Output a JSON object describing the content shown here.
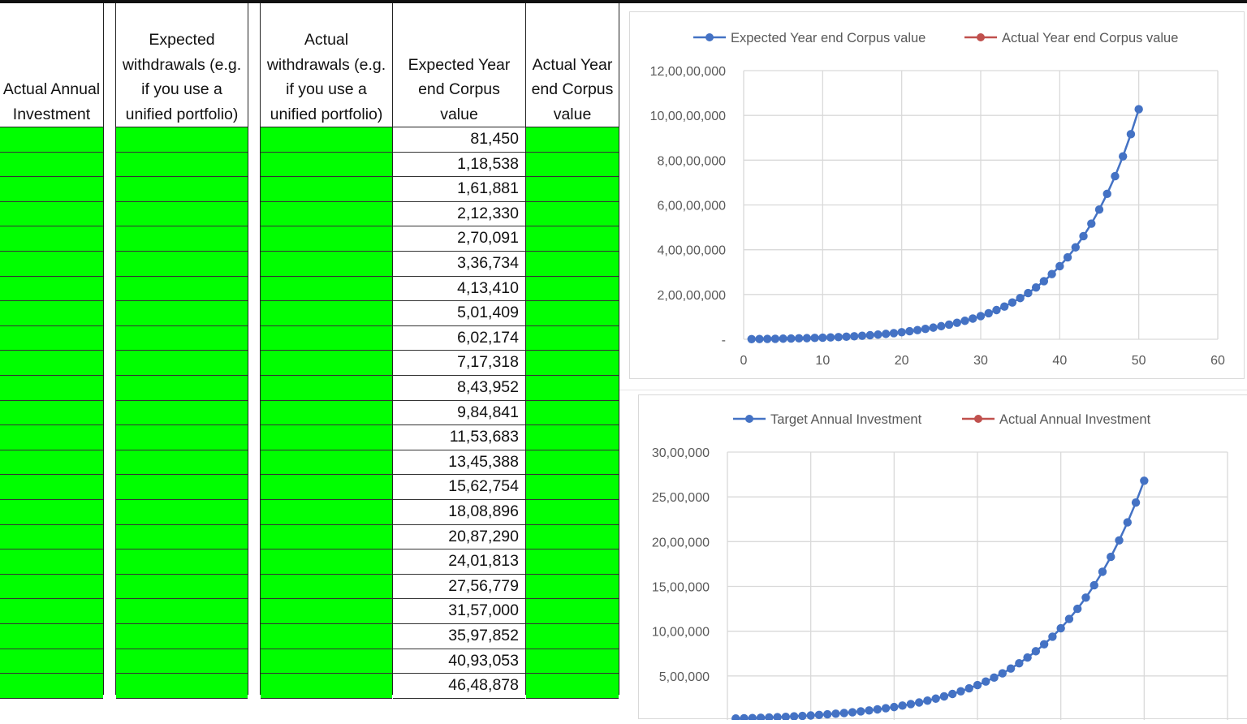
{
  "table": {
    "headers": {
      "actual_annual_investment": "Actual Annual Investment",
      "expected_withdrawals": "Expected withdrawals (e.g. if you use a unified portfolio)",
      "actual_withdrawals": "Actual withdrawals (e.g. if you use a unified portfolio)",
      "expected_corpus": "Expected Year end Corpus value",
      "actual_corpus": "Actual Year end Corpus value"
    },
    "expected_corpus_values": [
      "81,450",
      "1,18,538",
      "1,61,881",
      "2,12,330",
      "2,70,091",
      "3,36,734",
      "4,13,410",
      "5,01,409",
      "6,02,174",
      "7,17,318",
      "8,43,952",
      "9,84,841",
      "11,53,683",
      "13,45,388",
      "15,62,754",
      "18,08,896",
      "20,87,290",
      "24,01,813",
      "27,56,779",
      "31,57,000",
      "35,97,852",
      "40,93,053",
      "46,48,878"
    ],
    "input_cell_color": "#00ff00"
  },
  "chart_data": [
    {
      "type": "line",
      "legend": [
        {
          "name": "Expected Year end Corpus value",
          "color": "#4472c4"
        },
        {
          "name": "Actual Year end Corpus value",
          "color": "#c0504d"
        }
      ],
      "legend_position": "top",
      "grid": true,
      "xlim": [
        0,
        60
      ],
      "ylim": [
        0,
        120000000
      ],
      "x_ticks": [
        "0",
        "10",
        "20",
        "30",
        "40",
        "50",
        "60"
      ],
      "y_ticks": [
        {
          "value": 0,
          "label": "-"
        },
        {
          "value": 20000000,
          "label": "2,00,00,000"
        },
        {
          "value": 40000000,
          "label": "4,00,00,000"
        },
        {
          "value": 60000000,
          "label": "6,00,00,000"
        },
        {
          "value": 80000000,
          "label": "8,00,00,000"
        },
        {
          "value": 100000000,
          "label": "10,00,00,000"
        },
        {
          "value": 120000000,
          "label": "12,00,00,000"
        }
      ],
      "series": [
        {
          "name": "Expected Year end Corpus value",
          "x": [
            1,
            2,
            3,
            4,
            5,
            6,
            7,
            8,
            9,
            10,
            11,
            12,
            13,
            14,
            15,
            16,
            17,
            18,
            19,
            20,
            21,
            22,
            23,
            24,
            25,
            26,
            27,
            28,
            29,
            30,
            31,
            32,
            33,
            34,
            35,
            36,
            37,
            38,
            39,
            40,
            41,
            42,
            43,
            44,
            45,
            46,
            47,
            48,
            49,
            50
          ],
          "y": [
            81450,
            118538,
            161881,
            212330,
            270091,
            336734,
            413410,
            501409,
            602174,
            717318,
            843952,
            984841,
            1153683,
            1345388,
            1562754,
            1808896,
            2087290,
            2401813,
            2756779,
            3157000,
            3597852,
            4093053,
            4648878,
            5214000,
            5847000,
            6557000,
            7354000,
            8247000,
            9249000,
            10370000,
            11630000,
            13050000,
            14630000,
            16410000,
            18400000,
            20640000,
            23150000,
            25960000,
            29110000,
            32650000,
            36610000,
            41060000,
            46050000,
            51640000,
            57920000,
            64950000,
            72840000,
            81700000,
            91620000,
            102750000
          ]
        },
        {
          "name": "Actual Year end Corpus value",
          "x": [],
          "y": []
        }
      ]
    },
    {
      "type": "line",
      "legend": [
        {
          "name": "Target Annual Investment",
          "color": "#4472c4"
        },
        {
          "name": "Actual Annual Investment",
          "color": "#c0504d"
        }
      ],
      "legend_position": "top",
      "grid": true,
      "xlim": [
        0,
        60
      ],
      "ylim": [
        0,
        3000000
      ],
      "y_ticks": [
        {
          "value": 500000,
          "label": "5,00,000"
        },
        {
          "value": 1000000,
          "label": "10,00,000"
        },
        {
          "value": 1500000,
          "label": "15,00,000"
        },
        {
          "value": 2000000,
          "label": "20,00,000"
        },
        {
          "value": 2500000,
          "label": "25,00,000"
        },
        {
          "value": 3000000,
          "label": "30,00,000"
        }
      ],
      "series": [
        {
          "name": "Target Annual Investment",
          "x": [
            1,
            2,
            3,
            4,
            5,
            6,
            7,
            8,
            9,
            10,
            11,
            12,
            13,
            14,
            15,
            16,
            17,
            18,
            19,
            20,
            21,
            22,
            23,
            24,
            25,
            26,
            27,
            28,
            29,
            30,
            31,
            32,
            33,
            34,
            35,
            36,
            37,
            38,
            39,
            40,
            41,
            42,
            43,
            44,
            45,
            46,
            47,
            48,
            49,
            50
          ],
          "y": [
            25000,
            28000,
            30000,
            33000,
            37000,
            40000,
            44000,
            49000,
            54000,
            59000,
            65000,
            72000,
            79000,
            87000,
            95000,
            105000,
            115000,
            127000,
            140000,
            153000,
            169000,
            186000,
            204000,
            225000,
            247000,
            272000,
            299000,
            329000,
            362000,
            398000,
            438000,
            482000,
            530000,
            583000,
            642000,
            706000,
            776000,
            854000,
            939000,
            1033000,
            1137000,
            1250000,
            1375000,
            1513000,
            1664000,
            1830000,
            2014000,
            2215000,
            2436000,
            2680000
          ]
        },
        {
          "name": "Actual Annual Investment",
          "x": [],
          "y": []
        }
      ]
    }
  ]
}
